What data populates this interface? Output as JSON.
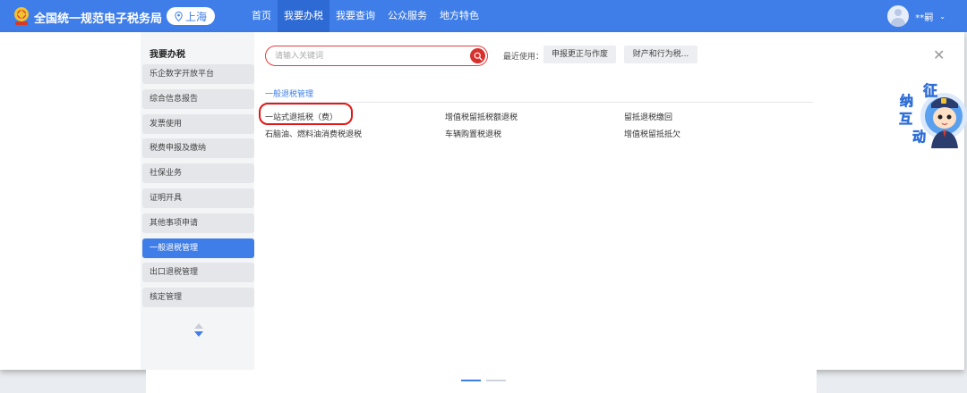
{
  "header": {
    "site_title": "全国统一规范电子税务局",
    "region": "上海",
    "nav": [
      "首页",
      "我要办税",
      "我要查询",
      "公众服务",
      "地方特色"
    ],
    "user_name": "**嗣"
  },
  "sidebar": {
    "title": "我要办税",
    "items": [
      "乐企数字开放平台",
      "综合信息报告",
      "发票使用",
      "税费申报及缴纳",
      "社保业务",
      "证明开具",
      "其他事项申请",
      "一般退税管理",
      "出口退税管理",
      "核定管理"
    ]
  },
  "search": {
    "placeholder": "请输入关键词",
    "value": ""
  },
  "recent": {
    "label": "最近使用：",
    "chips": [
      "申报更正与作废",
      "财产和行为税..."
    ]
  },
  "section": {
    "title": "一般退税管理",
    "items": [
      "一站式退抵税（费）",
      "增值税留抵税额退税",
      "留抵退税缴回",
      "石脑油、燃料油消费税退税",
      "车辆购置税退税",
      "增值税留抵抵欠"
    ]
  },
  "mascot": {
    "chars": [
      "征",
      "纳",
      "互",
      "动"
    ]
  },
  "colors": {
    "primary": "#3f7ee8",
    "active_nav": "#2e6ad4",
    "highlight": "#e01818"
  }
}
